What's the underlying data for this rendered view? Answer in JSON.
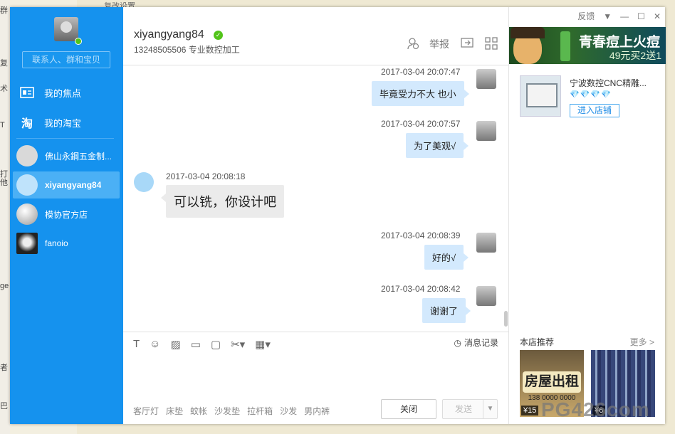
{
  "background": {
    "left_fragments": [
      "群",
      "复",
      "术",
      "T",
      "打",
      "他",
      "ge",
      "者",
      "巴"
    ],
    "top_text": "复改设置"
  },
  "sidebar": {
    "search_placeholder": "联系人、群和宝贝",
    "nav": [
      {
        "label": "我的焦点",
        "icon": "focus-icon"
      },
      {
        "label": "我的淘宝",
        "icon": "taobao-icon"
      }
    ],
    "contacts": [
      {
        "name": "佛山永鋼五金制...",
        "active": false,
        "avatar_color": "#d9d9d9"
      },
      {
        "name": "xiyangyang84",
        "active": true,
        "avatar_color": "#bfe3fb"
      },
      {
        "name": "模协官方店",
        "active": false,
        "avatar_color": "#c7c7c7"
      },
      {
        "name": "fanoio",
        "active": false,
        "avatar_color": "#333333"
      }
    ]
  },
  "header": {
    "name": "xiyangyang84",
    "subtitle": "13248505506 专业数控加工",
    "report_label": "举报"
  },
  "window": {
    "feedback_label": "反馈"
  },
  "messages": [
    {
      "time": "2017-03-04 20:07:47",
      "text": "毕竟受力不大 也小",
      "side": "right"
    },
    {
      "time": "2017-03-04 20:07:57",
      "text": "为了美观√",
      "side": "right"
    },
    {
      "time": "2017-03-04 20:08:18",
      "text": "可以铣，你设计吧",
      "side": "left"
    },
    {
      "time": "2017-03-04 20:08:39",
      "text": "好的√",
      "side": "right"
    },
    {
      "time": "2017-03-04 20:08:42",
      "text": "谢谢了",
      "side": "right"
    }
  ],
  "input": {
    "history_label": "消息记录",
    "tags": [
      "客厅灯",
      "床垫",
      "蚊帐",
      "沙发垫",
      "拉杆箱",
      "沙发",
      "男内裤"
    ],
    "close_label": "关闭",
    "send_label": "发送"
  },
  "right_panel": {
    "ad_title": "青春痘上火痘",
    "ad_sub": "49元买2送1",
    "shop_name": "宁波数控CNC精雕...",
    "diamonds": "💎💎💎💎",
    "enter_label": "进入店铺",
    "rec_title": "本店推荐",
    "rec_more": "更多 >",
    "rec_items": [
      {
        "image_text": "房屋出租",
        "image_subtext": "138 0000 0000",
        "price": "¥15"
      },
      {
        "image_text": "",
        "image_subtext": "",
        "price": "¥6"
      }
    ]
  },
  "watermark": "PG426com"
}
